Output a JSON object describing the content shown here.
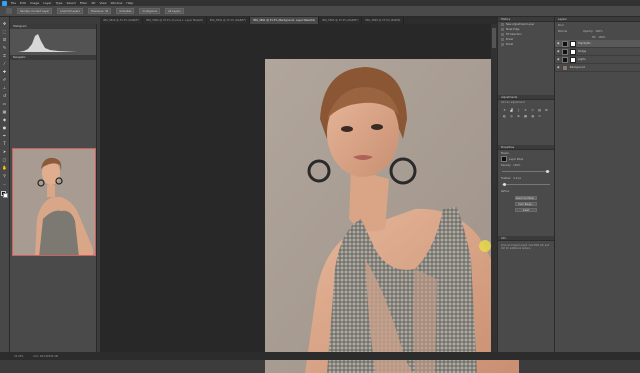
{
  "menu": {
    "items": [
      "File",
      "Edit",
      "Image",
      "Layer",
      "Type",
      "Select",
      "Filter",
      "3D",
      "View",
      "Window",
      "Help"
    ]
  },
  "options": {
    "fields": [
      "Sample: Current Layer",
      "Load All Layers",
      "Tolerance: 32",
      "Anti-alias",
      "Contiguous",
      "All Layers"
    ]
  },
  "tabs": [
    {
      "label": "IMG_5890 @ 33.3% (RGB/8*)",
      "active": false
    },
    {
      "label": "IMG_5890 @ 33.3% (Curves 1, Layer Mask/8)",
      "active": false
    },
    {
      "label": "IMG_5891 @ 33.3% (RGB/8*)",
      "active": false
    },
    {
      "label": "IMG_5891 @ 33.3% (Background, Layer Mask/16)",
      "active": true
    },
    {
      "label": "IMG_5895 @ 33.3% (RGB/8*)",
      "active": false
    },
    {
      "label": "IMG_5899 @ 33.3% (RGB/8)",
      "active": false
    }
  ],
  "panels": {
    "histogram": "Histogram",
    "navigator": "Navigator",
    "history": "History",
    "history_items": [
      "New Adjustment Layer",
      "Mask Edge",
      "Fill Selection",
      "Brush",
      "Brush"
    ],
    "adjustments": "Adjustments",
    "add_adjustment": "Add an adjustment",
    "properties": "Properties",
    "masks": "Masks",
    "layer_mask": "Layer Mask",
    "density": "Density:",
    "density_val": "100%",
    "feather": "Feather:",
    "feather_val": "0.0 px",
    "refine": "Refine:",
    "select_mask_btn": "Select and Mask...",
    "color_range_btn": "Color Range...",
    "invert_btn": "Invert",
    "info": "Info",
    "info_text": "Click and drag to paint. Use Shift, Alt, and Ctrl for additional options.",
    "layers": "Layers",
    "layers_kind": "Kind",
    "blend_mode": "Normal",
    "opacity_label": "Opacity:",
    "opacity_val": "100%",
    "fill_label": "Fill:",
    "fill_val": "100%",
    "layer_rows": [
      {
        "name": "Highlights",
        "thumb": "white",
        "selected": true
      },
      {
        "name": "Dodge",
        "thumb": "black",
        "selected": false
      },
      {
        "name": "Lights",
        "thumb": "black",
        "selected": false
      },
      {
        "name": "Background",
        "thumb": "photo",
        "selected": false
      }
    ]
  },
  "status": {
    "zoom": "33.33%",
    "doc": "Doc: 69.1M/345.4M"
  },
  "colors": {
    "accent": "#2fa3f7",
    "background_panel": "#4a4a4a",
    "canvas": "#282828",
    "nav_frame": "#d06060",
    "cursor": "#e8d84a"
  },
  "icons": [
    "move-icon",
    "marquee-icon",
    "lasso-icon",
    "quick-select-icon",
    "crop-icon",
    "eyedropper-icon",
    "healing-icon",
    "brush-icon",
    "stamp-icon",
    "history-brush-icon",
    "eraser-icon",
    "gradient-icon",
    "blur-icon",
    "dodge-icon",
    "pen-icon",
    "type-icon",
    "path-select-icon",
    "shape-icon",
    "hand-icon",
    "zoom-icon"
  ]
}
